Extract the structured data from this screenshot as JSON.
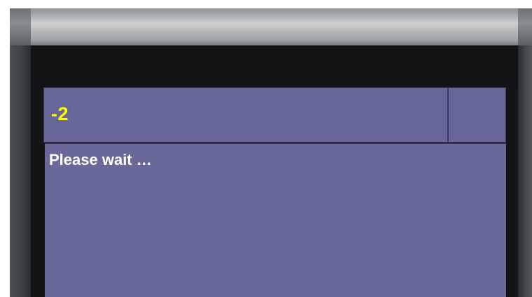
{
  "display": {
    "value": "-2",
    "message": "Please wait …"
  },
  "colors": {
    "panel": "#666798",
    "value_text": "#ffff00",
    "message_text": "#ffffff",
    "background": "#131416"
  }
}
